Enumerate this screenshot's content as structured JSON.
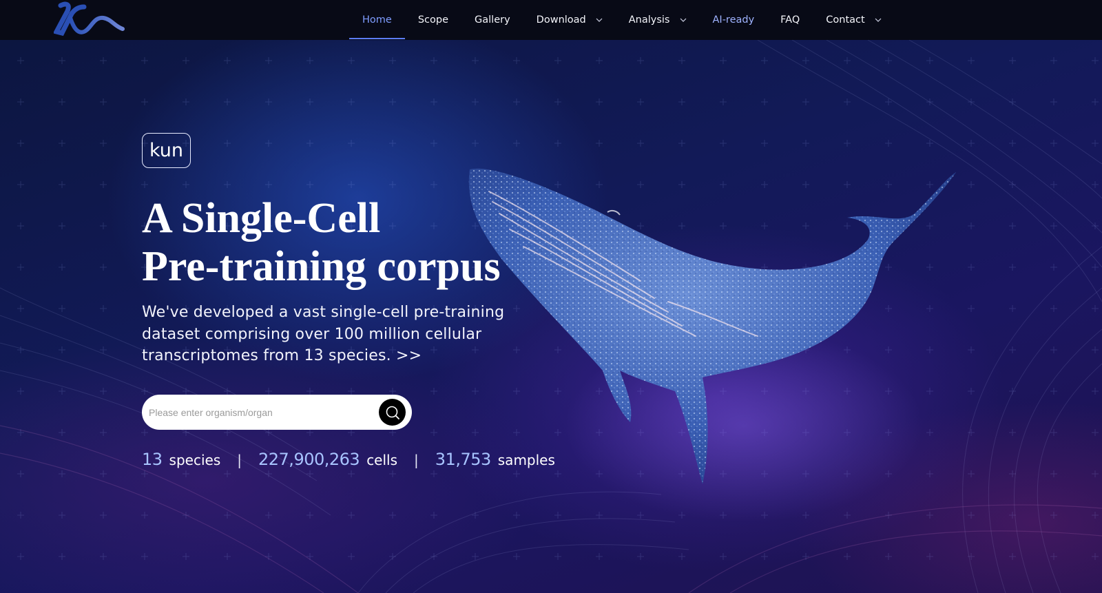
{
  "header": {
    "nav": [
      {
        "label": "Home"
      },
      {
        "label": "Scope"
      },
      {
        "label": "Gallery"
      },
      {
        "label": "Download"
      },
      {
        "label": "Analysis"
      },
      {
        "label": "AI-ready"
      },
      {
        "label": "FAQ"
      },
      {
        "label": "Contact"
      }
    ]
  },
  "hero": {
    "badge": "kun",
    "title_line1": "A Single-Cell",
    "title_line2": "Pre-training corpus",
    "subtitle": "We've developed a vast single-cell pre-training dataset comprising over 100 million cellular transcriptomes from 13 species.",
    "more_link": ">>",
    "search_placeholder": "Please enter organism/organ",
    "stats": [
      {
        "value": "13",
        "label": "species"
      },
      {
        "value": "227,900,263",
        "label": "cells"
      },
      {
        "value": "31,753",
        "label": "samples"
      }
    ],
    "separator": "|"
  },
  "colors": {
    "nav_active": "#7f9dff",
    "nav_active_underline": "#5d7df5",
    "stat_number": "#a8c4ff",
    "header_bg": "#080a16",
    "hero_bg": "#121a58"
  },
  "icons": {
    "logo": "kun-logo",
    "chevron": "chevron-down-icon",
    "search": "search-icon",
    "whale": "whale-illustration"
  }
}
